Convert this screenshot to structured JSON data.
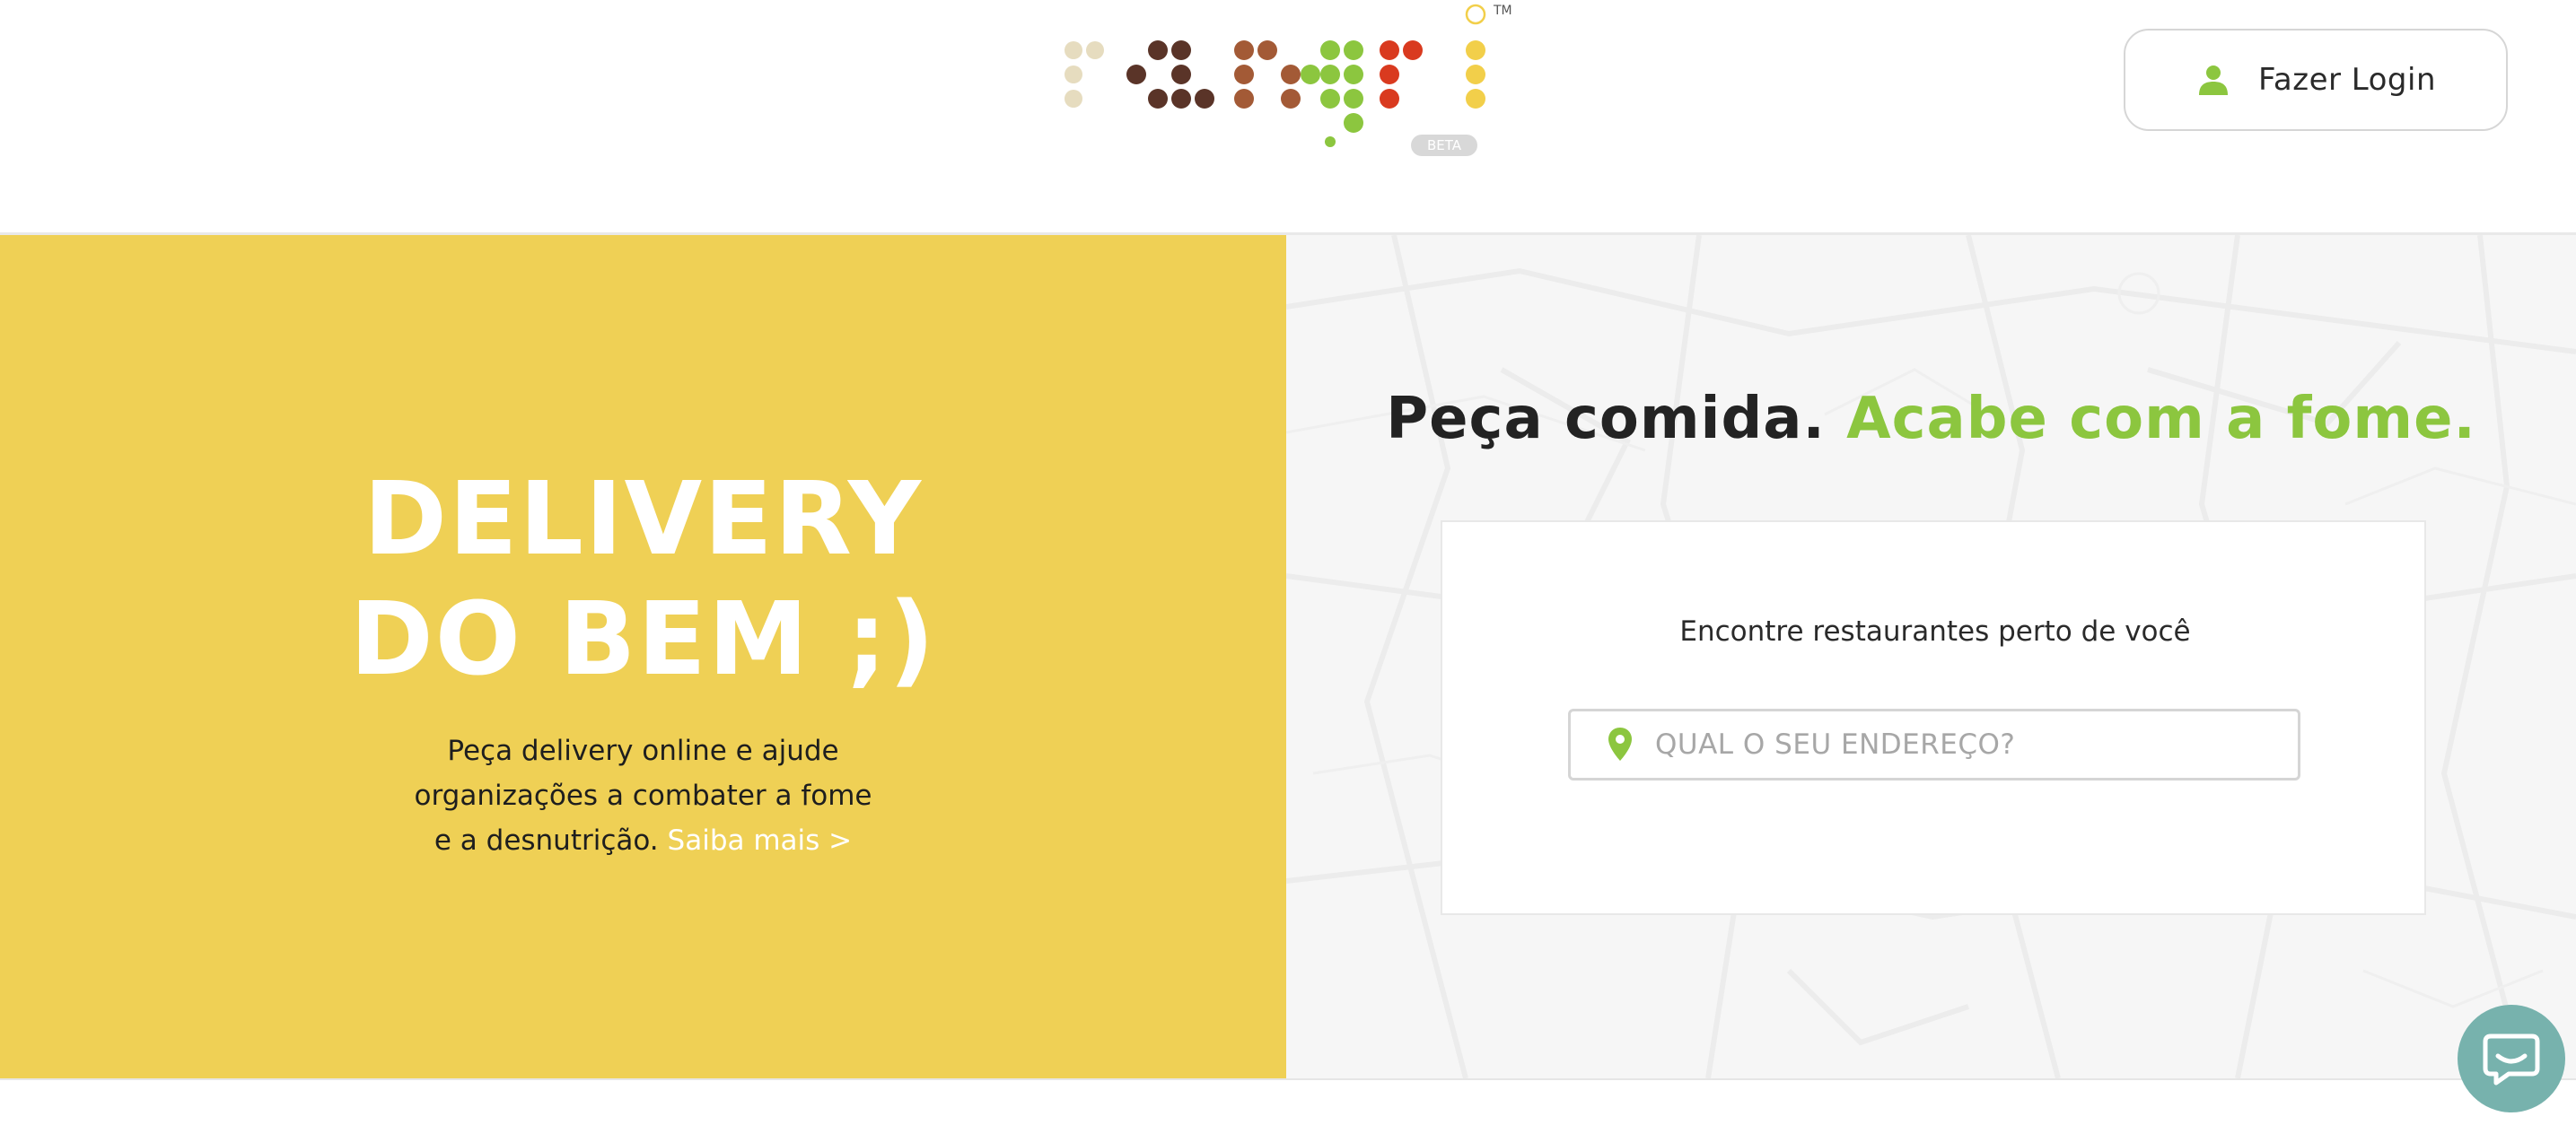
{
  "header": {
    "logo": {
      "name": "rangri-logo",
      "wordmark": "rangri",
      "badge": "BETA",
      "trademark": "TM"
    },
    "login": {
      "label": "Fazer Login",
      "icon": "user-icon"
    }
  },
  "hero": {
    "title_line1": "DELIVERY",
    "title_line2": "DO BEM ;)",
    "desc_line1": "Peça delivery online e ajude",
    "desc_line2": "organizações a combater a fome",
    "desc_line3": "e a desnutrição.",
    "link": "Saiba mais >"
  },
  "search": {
    "headline_main": "Peça comida.",
    "headline_accent": "Acabe com a fome.",
    "card_title": "Encontre restaurantes perto de você",
    "placeholder": "QUAL O SEU ENDEREÇO?",
    "value": "",
    "icon": "location-pin-icon"
  },
  "chat": {
    "icon": "chat-bubble-icon"
  },
  "colors": {
    "yellow": "#efd055",
    "green": "#8cc63f",
    "chat": "#77b2ad"
  }
}
